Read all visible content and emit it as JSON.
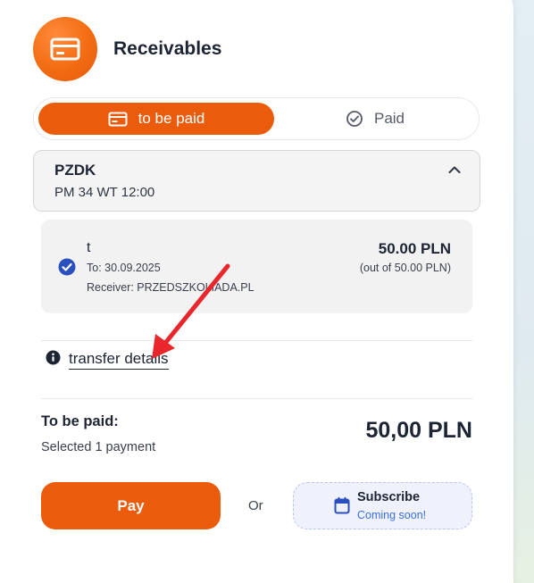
{
  "header": {
    "title": "Receivables",
    "icon": "credit-card-icon",
    "accent": "#ea5b0c"
  },
  "tabs": [
    {
      "label": "to be paid",
      "icon": "credit-card-icon",
      "active": true
    },
    {
      "label": "Paid",
      "icon": "check-circle-icon",
      "active": false
    }
  ],
  "group": {
    "name": "PZDK",
    "subtitle": "PM 34 WT 12:00",
    "expanded": true
  },
  "payment": {
    "title": "t",
    "due": "To: 30.09.2025",
    "receiver": "Receiver: PRZEDSZKOLIADA.PL",
    "amount": "50.00 PLN",
    "out_of": "(out of 50.00 PLN)",
    "checked": true
  },
  "transfer": {
    "label": "transfer details"
  },
  "total": {
    "label": "To be paid:",
    "selected": "Selected 1 payment",
    "amount": "50,00 PLN"
  },
  "actions": {
    "pay_label": "Pay",
    "or_label": "Or",
    "subscribe_label": "Subscribe",
    "subscribe_note": "Coming soon!"
  },
  "colors": {
    "primary": "#ea5b0c",
    "check": "#2a4fbf",
    "link_blue": "#3b6fd8",
    "arrow": "#e8262b"
  }
}
